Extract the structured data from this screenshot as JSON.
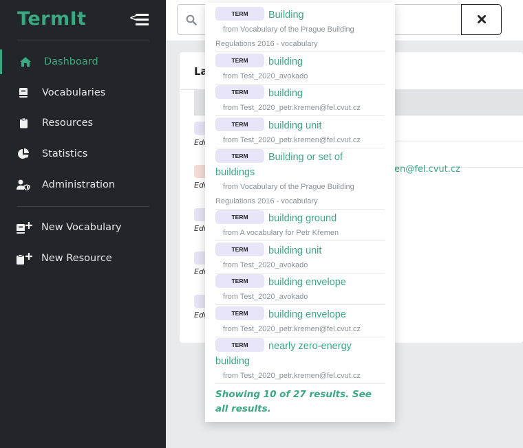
{
  "app": {
    "name": "TermIt"
  },
  "sidebar": {
    "items": [
      {
        "label": "Dashboard",
        "icon": "home-icon",
        "active": true
      },
      {
        "label": "Vocabularies",
        "icon": "book-icon"
      },
      {
        "label": "Resources",
        "icon": "clipboard-icon"
      },
      {
        "label": "Statistics",
        "icon": "pie-chart-icon"
      },
      {
        "label": "Administration",
        "icon": "user-shield-icon"
      }
    ],
    "actions": [
      {
        "label": "New Vocabulary",
        "icon": "book-plus-icon"
      },
      {
        "label": "New Resource",
        "icon": "clipboard-plus-icon"
      }
    ]
  },
  "search": {
    "value": "",
    "clear_icon": "close-icon"
  },
  "card": {
    "title_partial": "La",
    "row_label_partial": "Edi",
    "link_partial": "en@fel.cvut.cz"
  },
  "results": {
    "badge": "TERM",
    "items": [
      {
        "name": "Building",
        "from": "from Vocabulary of the Prague Building Regulations 2016 - vocabulary"
      },
      {
        "name": "building",
        "from": "from Test_2020_avokado"
      },
      {
        "name": "building",
        "from": "from Test_2020_petr.kremen@fel.cvut.cz"
      },
      {
        "name": "building unit",
        "from": "from Test_2020_petr.kremen@fel.cvut.cz"
      },
      {
        "name": "Building or set of buildings",
        "from": "from Vocabulary of the Prague Building Regulations 2016 - vocabulary"
      },
      {
        "name": "building ground",
        "from": "from A vocabulary for Petr Křemen"
      },
      {
        "name": "building unit",
        "from": "from Test_2020_avokado"
      },
      {
        "name": "building envelope",
        "from": "from Test_2020_avokado"
      },
      {
        "name": "building envelope",
        "from": "from Test_2020_petr.kremen@fel.cvut.cz"
      },
      {
        "name": "nearly zero-energy building",
        "from": "from Test_2020_petr.kremen@fel.cvut.cz"
      }
    ],
    "showing": "Showing 10 of 27 results. See all results."
  },
  "colors": {
    "accent": "#3aa882",
    "sidebar_bg": "#22252a",
    "badge_bg": "#e8e5f8"
  }
}
